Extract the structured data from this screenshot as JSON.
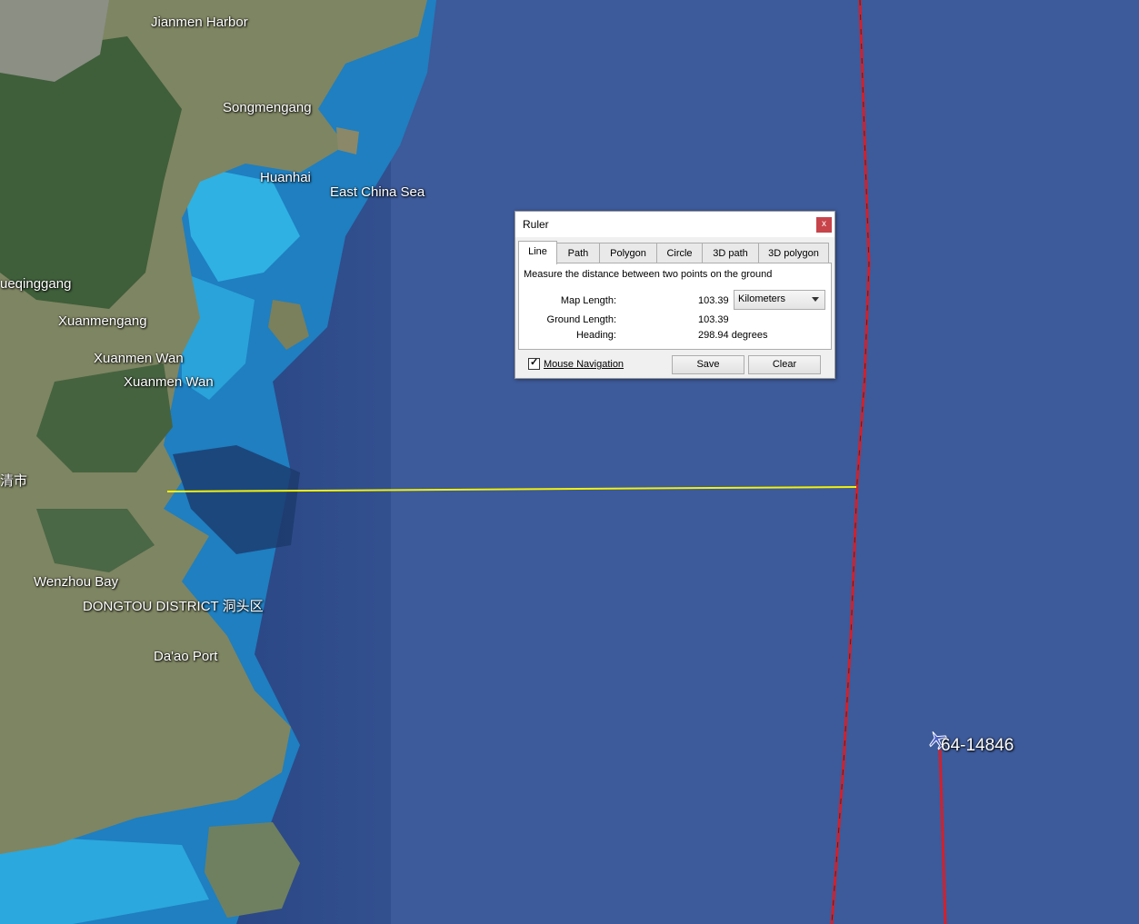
{
  "map": {
    "place_labels": [
      {
        "id": "jianmen-harbor",
        "text": "Jianmen Harbor"
      },
      {
        "id": "songmengang",
        "text": "Songmengang"
      },
      {
        "id": "huanhai",
        "text": "Huanhai"
      },
      {
        "id": "east-china-sea",
        "text": "East China Sea"
      },
      {
        "id": "yueqinggang",
        "text": "ueqinggang"
      },
      {
        "id": "xuanmengang",
        "text": "Xuanmengang"
      },
      {
        "id": "xuanmen-wan-1",
        "text": "Xuanmen Wan"
      },
      {
        "id": "xuanmen-wan-2",
        "text": "Xuanmen Wan"
      },
      {
        "id": "yueqing-city",
        "text": "清市"
      },
      {
        "id": "wenzhou-bay",
        "text": "Wenzhou Bay"
      },
      {
        "id": "dongtou-district",
        "text": "DONGTOU DISTRICT 洞头区"
      },
      {
        "id": "daao-port",
        "text": "Da'ao Port"
      }
    ],
    "aircraft": {
      "label": "64-14846",
      "icon": "airplane-icon"
    },
    "colors": {
      "ruler_line": "#f2f20a",
      "flight_track": "#d4202a",
      "sea": "#3d5a9a",
      "land": "#7d8560"
    }
  },
  "ruler": {
    "title": "Ruler",
    "close_label": "x",
    "tabs": [
      "Line",
      "Path",
      "Polygon",
      "Circle",
      "3D path",
      "3D polygon"
    ],
    "active_tab": "Line",
    "description": "Measure the distance between two points on the ground",
    "map_length_label": "Map Length:",
    "map_length_value": "103.39",
    "unit": "Kilometers",
    "ground_length_label": "Ground Length:",
    "ground_length_value": "103.39",
    "heading_label": "Heading:",
    "heading_value": "298.94 degrees",
    "mouse_navigation_label": "Mouse Navigation",
    "mouse_navigation_checked": true,
    "save_label": "Save",
    "clear_label": "Clear"
  }
}
